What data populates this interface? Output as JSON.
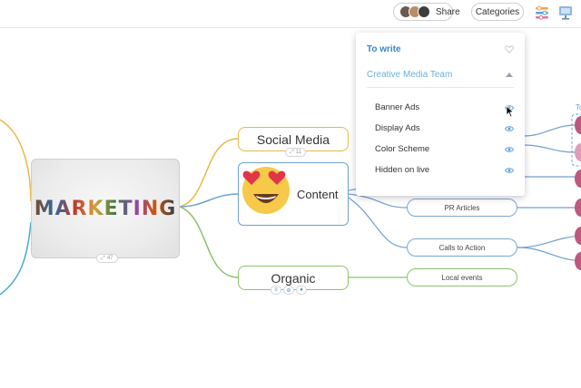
{
  "header": {
    "share_label": "Share",
    "categories_label": "Categories",
    "icons": [
      "collaborators-avatars",
      "filter-sliders-icon",
      "presentation-icon"
    ]
  },
  "mindmap": {
    "central_node": {
      "label": "MARKETING",
      "badge": "47"
    },
    "nodes": {
      "social_media": "Social Media",
      "content": "Content",
      "content_badge": "11",
      "content_icon": "heart-eyes-emoji-icon",
      "organic": "Organic"
    },
    "subnodes": {
      "pr_articles": "PR Articles",
      "calls_to_action": "Calls to Action",
      "local_events": "Local events"
    },
    "edge_label_right": "To"
  },
  "categories_dropdown": {
    "sections": [
      {
        "label": "To write",
        "icon": "heart-outline-icon"
      },
      {
        "label": "Creative Media Team",
        "icon": "triangle-up-icon"
      }
    ],
    "items": [
      {
        "label": "Banner Ads",
        "icon": "eye-icon"
      },
      {
        "label": "Display Ads",
        "icon": "eye-icon"
      },
      {
        "label": "Color Scheme",
        "icon": "eye-icon"
      },
      {
        "label": "Hidden on live",
        "icon": "eye-icon"
      }
    ]
  },
  "colors": {
    "social_branch": "#e9b84a",
    "content_branch": "#6fa0d0",
    "organic_branch": "#8cc36b",
    "dropdown_heading": "#3b87c6",
    "dropdown_subheading": "#69b1d8",
    "right_nodes": "#c0577e"
  }
}
